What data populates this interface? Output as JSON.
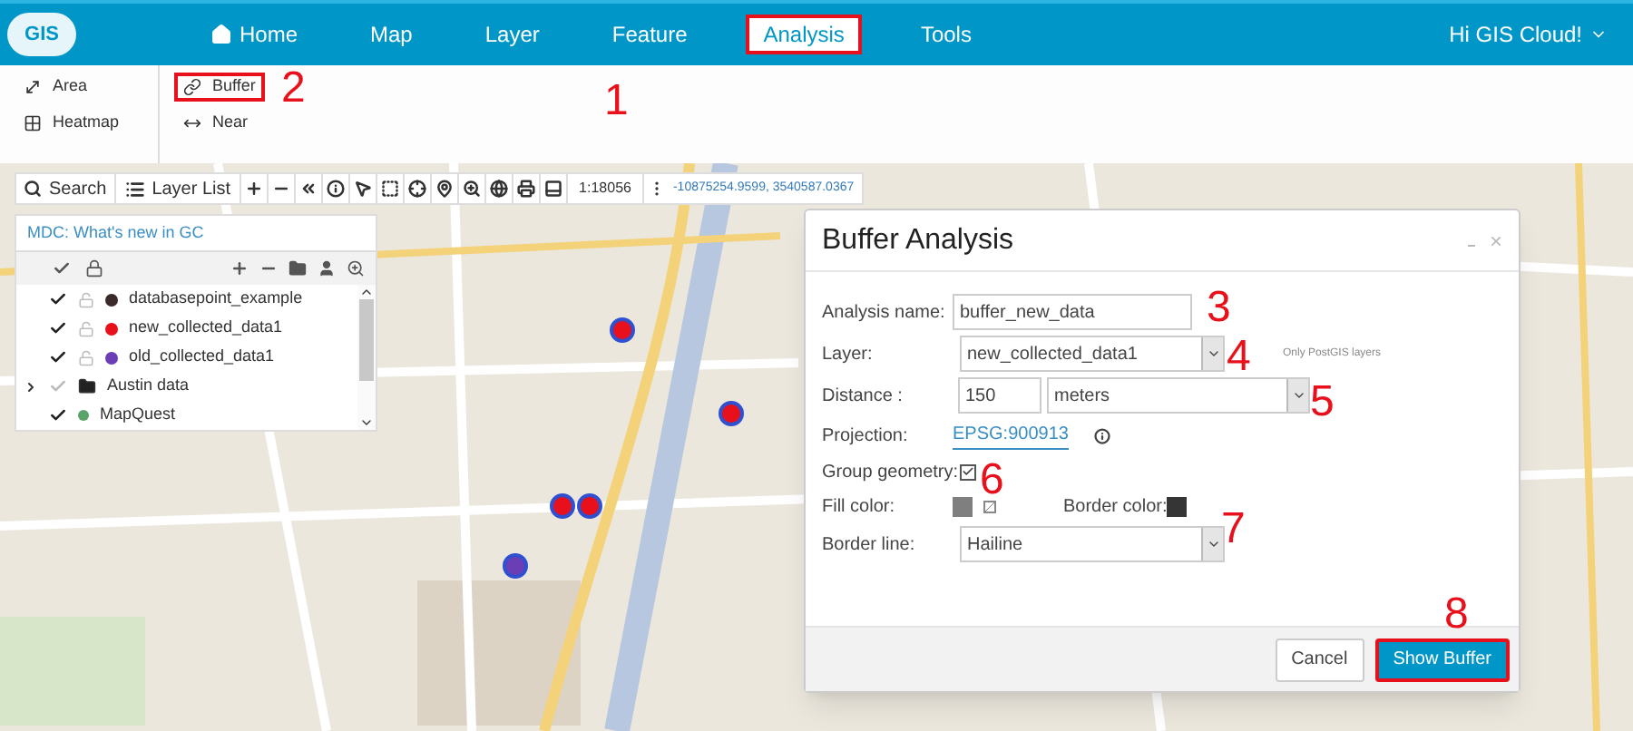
{
  "header": {
    "logo": "GIS",
    "nav": [
      {
        "label": "Home",
        "selected": false,
        "highlighted": false
      },
      {
        "label": "Map",
        "selected": false,
        "highlighted": false
      },
      {
        "label": "Layer",
        "selected": false,
        "highlighted": false
      },
      {
        "label": "Feature",
        "selected": false,
        "highlighted": false
      },
      {
        "label": "Analysis",
        "selected": true,
        "highlighted": true
      },
      {
        "label": "Tools",
        "selected": false,
        "highlighted": false
      }
    ],
    "user": "Hi GIS Cloud!"
  },
  "ribbon": {
    "groups": [
      [
        {
          "label": "Area",
          "highlighted": false
        },
        {
          "label": "Heatmap",
          "highlighted": false
        }
      ],
      [
        {
          "label": "Buffer",
          "highlighted": true
        },
        {
          "label": "Near",
          "highlighted": false
        }
      ]
    ]
  },
  "toolbar": {
    "search": "Search",
    "layer_list": "Layer List",
    "scale": "1:18056",
    "coordinates": "-10875254.9599, 3540587.0367"
  },
  "layer_panel": {
    "title": "MDC: What's new in GC",
    "layers": [
      {
        "name": "databasepoint_example",
        "kind": "point",
        "checked": true,
        "color": "#3a2a2a"
      },
      {
        "name": "new_collected_data1",
        "kind": "point",
        "checked": true,
        "color": "#e8101a"
      },
      {
        "name": "old_collected_data1",
        "kind": "point",
        "checked": true,
        "color": "#6a3fb5"
      },
      {
        "name": "Austin data",
        "kind": "folder",
        "checked": false,
        "expanded": false
      },
      {
        "name": "MapQuest",
        "kind": "basemap",
        "checked": true
      }
    ]
  },
  "dialog": {
    "title": "Buffer Analysis",
    "close": "×",
    "fields": [
      {
        "kind": "text",
        "label": "Analysis name:",
        "value": "buffer_new_data"
      },
      {
        "kind": "select",
        "label": "Layer:",
        "value": "new_collected_data1",
        "hint": "Only PostGIS layers"
      },
      {
        "kind": "distance",
        "label": "Distance :",
        "value": "150",
        "unit": "meters"
      },
      {
        "kind": "link",
        "label": "Projection:",
        "value": "EPSG:900913"
      },
      {
        "kind": "checkbox",
        "label": "Group geometry:",
        "checked": true
      },
      {
        "kind": "colors",
        "transparent": true,
        "swatches": [
          {
            "label": "Fill color:",
            "color": "#7f7f7f"
          },
          {
            "label": "Border color:",
            "color": "#353535"
          }
        ]
      },
      {
        "kind": "select",
        "label": "Border line:",
        "value": "Hailine"
      }
    ],
    "buttons": [
      {
        "label": "Cancel",
        "primary": false,
        "highlighted": false
      },
      {
        "label": "Show Buffer",
        "primary": true,
        "highlighted": true
      }
    ]
  },
  "annotations": [
    "1",
    "2",
    "3",
    "4",
    "5",
    "6",
    "7",
    "8"
  ]
}
